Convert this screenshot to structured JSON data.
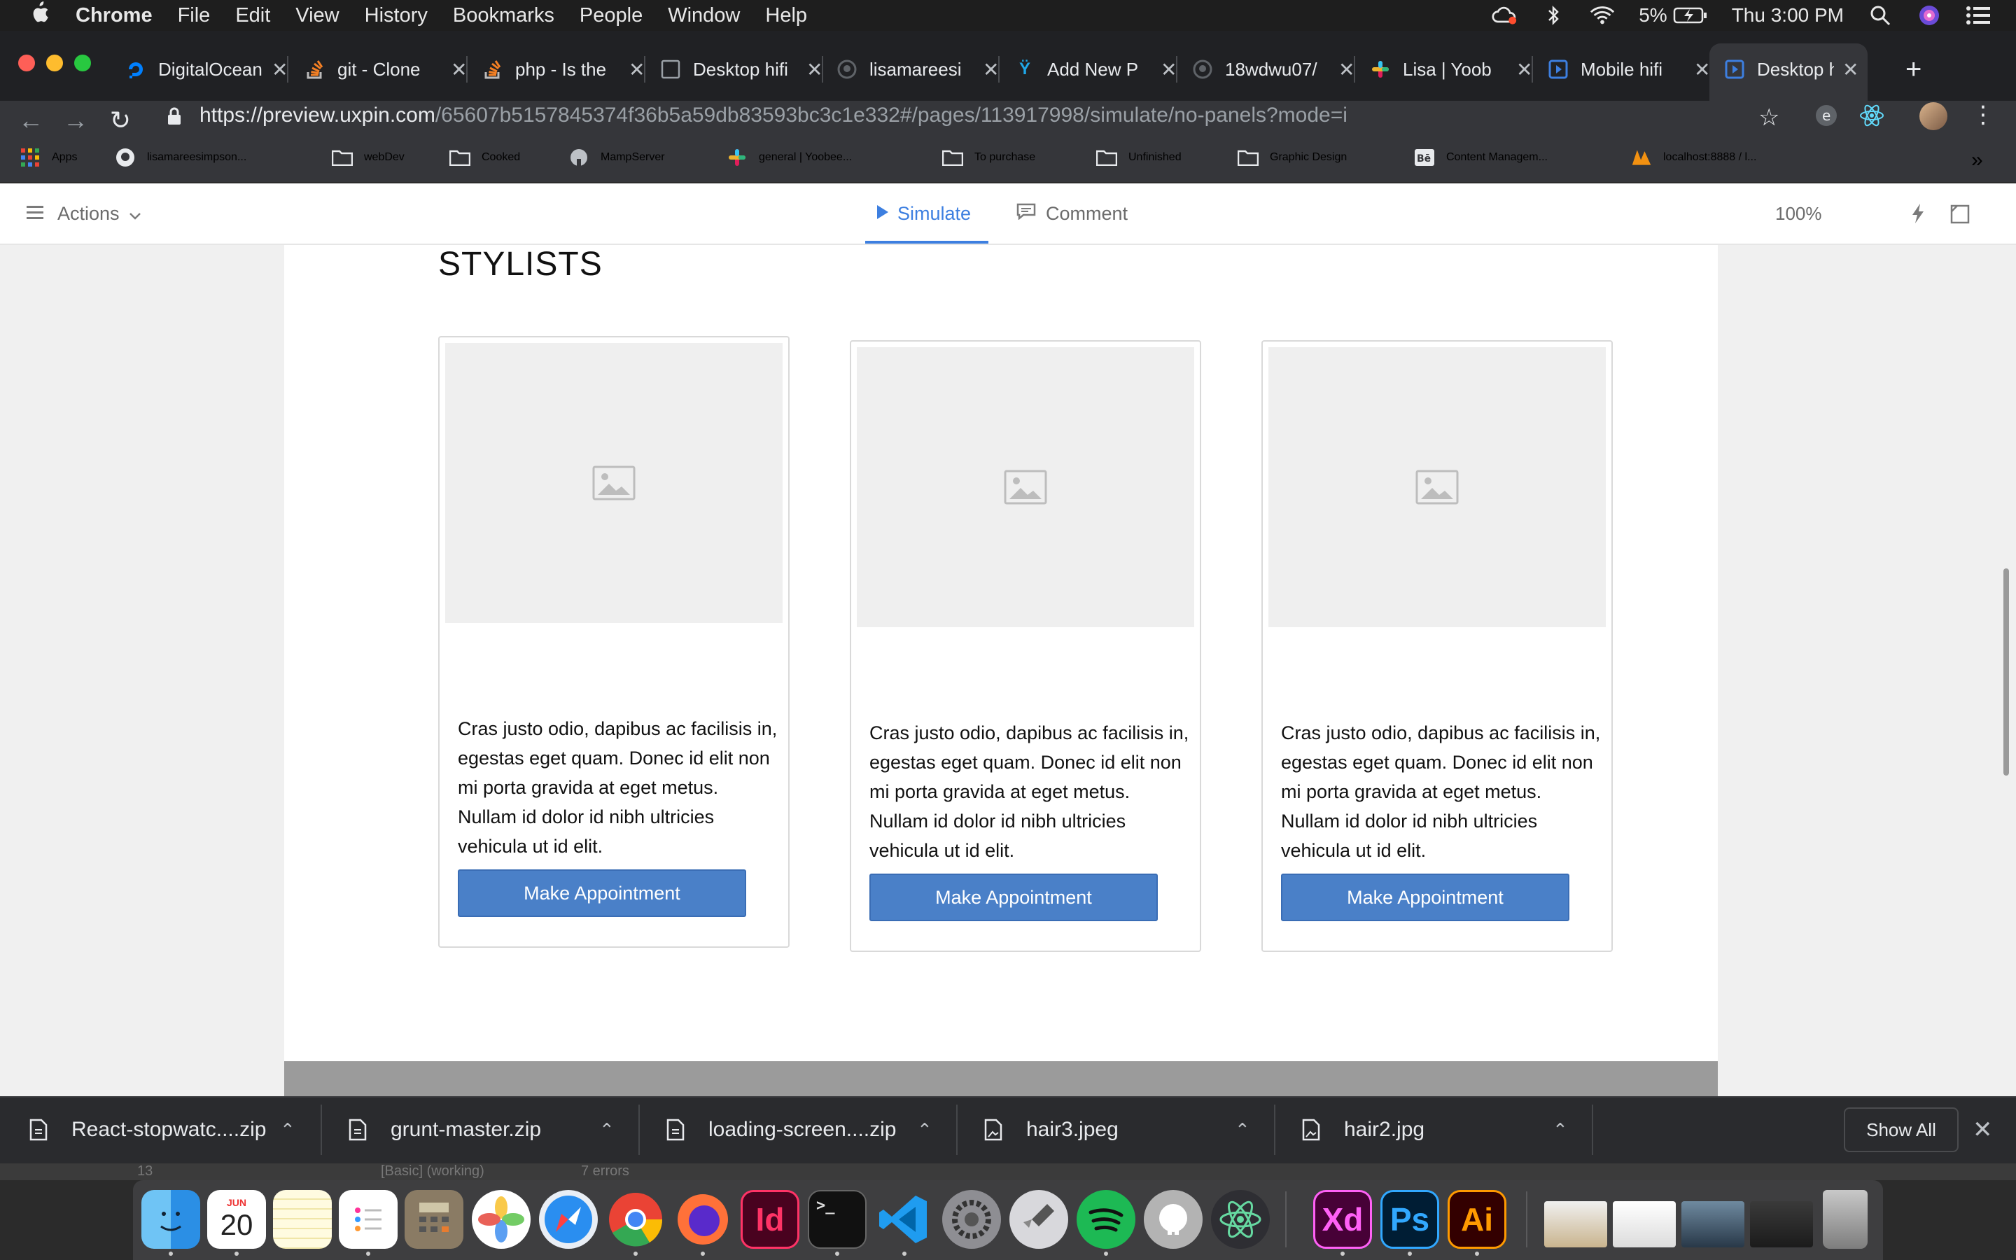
{
  "menubar": {
    "app": "Chrome",
    "items": [
      "File",
      "Edit",
      "View",
      "History",
      "Bookmarks",
      "People",
      "Window",
      "Help"
    ],
    "battery": "5%",
    "clock": "Thu 3:00 PM"
  },
  "tabs": [
    {
      "label": "DigitalOcean",
      "icon": "digitalocean-icon",
      "color": "#0080ff"
    },
    {
      "label": "git - Clone",
      "icon": "stackoverflow-icon",
      "color": "#f48024"
    },
    {
      "label": "php - Is the",
      "icon": "stackoverflow-icon",
      "color": "#f48024"
    },
    {
      "label": "Desktop hifi",
      "icon": "page-icon",
      "color": "#9aa0a6"
    },
    {
      "label": "lisamareesi",
      "icon": "github-icon",
      "color": "#e8eaed"
    },
    {
      "label": "Add New P",
      "icon": "wordpress-icon",
      "color": "#21759b"
    },
    {
      "label": "18wdwu07/",
      "icon": "github-icon",
      "color": "#e8eaed"
    },
    {
      "label": "Lisa | Yoob",
      "icon": "slack-icon",
      "color": "#e01e5a"
    },
    {
      "label": "Mobile hifi",
      "icon": "uxpin-icon",
      "color": "#3d7fe0"
    },
    {
      "label": "Desktop hi",
      "icon": "uxpin-icon",
      "color": "#3d7fe0"
    }
  ],
  "url": {
    "host": "https://preview.uxpin.com",
    "path": "/65607b5157845374f36b5a59db83593bc3c1e332#/pages/113917998/simulate/no-panels?mode=i"
  },
  "bookmarks": [
    "Apps",
    "lisamareesimpson...",
    "webDev",
    "Cooked",
    "MampServer",
    "general | Yoobee...",
    "To purchase",
    "Unfinished",
    "Graphic Design",
    "Content Managem...",
    "localhost:8888 / l..."
  ],
  "uxpin": {
    "actions": "Actions",
    "simulate": "Simulate",
    "comment": "Comment",
    "zoom": "100%"
  },
  "page": {
    "title": "STYLISTS",
    "cards": [
      {
        "text": "Cras justo odio, dapibus ac facilisis in, egestas eget quam. Donec id elit non mi porta gravida at eget metus. Nullam id dolor id nibh ultricies vehicula ut id elit.",
        "button": "Make Appointment"
      },
      {
        "text": "Cras justo odio, dapibus ac facilisis in, egestas eget quam. Donec id elit non mi porta gravida at eget metus. Nullam id dolor id nibh ultricies vehicula ut id elit.",
        "button": "Make Appointment"
      },
      {
        "text": "Cras justo odio, dapibus ac facilisis in, egestas eget quam. Donec id elit non mi porta gravida at eget metus. Nullam id dolor id nibh ultricies vehicula ut id elit.",
        "button": "Make Appointment"
      }
    ]
  },
  "downloads": {
    "items": [
      "React-stopwatc....zip",
      "grunt-master.zip",
      "loading-screen....zip",
      "hair3.jpeg",
      "hair2.jpg"
    ],
    "show_all": "Show All"
  },
  "stray_bar": {
    "page": "13",
    "status": "[Basic] (working)",
    "errors": "7 errors"
  },
  "dock": {
    "calendar_month": "JUN",
    "calendar_day": "20",
    "apps": [
      "Finder",
      "Calendar",
      "Notes",
      "Reminders",
      "Calculator",
      "Photos",
      "Safari",
      "Chrome",
      "Firefox",
      "InDesign",
      "Terminal",
      "VS Code",
      "System Preferences",
      "Launchpad",
      "Spotify",
      "Sequel Pro",
      "Atom",
      "Adobe XD",
      "Photoshop",
      "Illustrator"
    ],
    "xd": "Xd",
    "ps": "Ps",
    "ai": "Ai",
    "id": "Id"
  }
}
